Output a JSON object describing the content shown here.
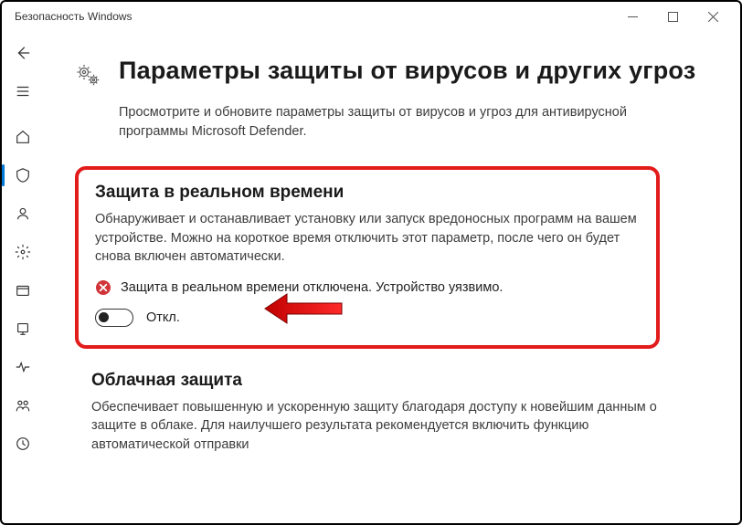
{
  "window": {
    "title": "Безопасность Windows"
  },
  "page": {
    "heading": "Параметры защиты от вирусов и других угроз",
    "subtitle": "Просмотрите и обновите параметры защиты от вирусов и угроз для антивирусной программы Microsoft Defender."
  },
  "realtime": {
    "title": "Защита в реальном времени",
    "desc": "Обнаруживает и останавливает установку или запуск вредоносных программ на вашем устройстве. Можно на короткое время отключить этот параметр, после чего он будет снова включен автоматически.",
    "alert": "Защита в реальном времени отключена. Устройство уязвимо.",
    "toggle_label": "Откл."
  },
  "cloud": {
    "title": "Облачная защита",
    "desc": "Обеспечивает повышенную и ускоренную защиту благодаря доступу к новейшим данным о защите в облаке. Для наилучшего результата рекомендуется включить функцию автоматической отправки"
  }
}
